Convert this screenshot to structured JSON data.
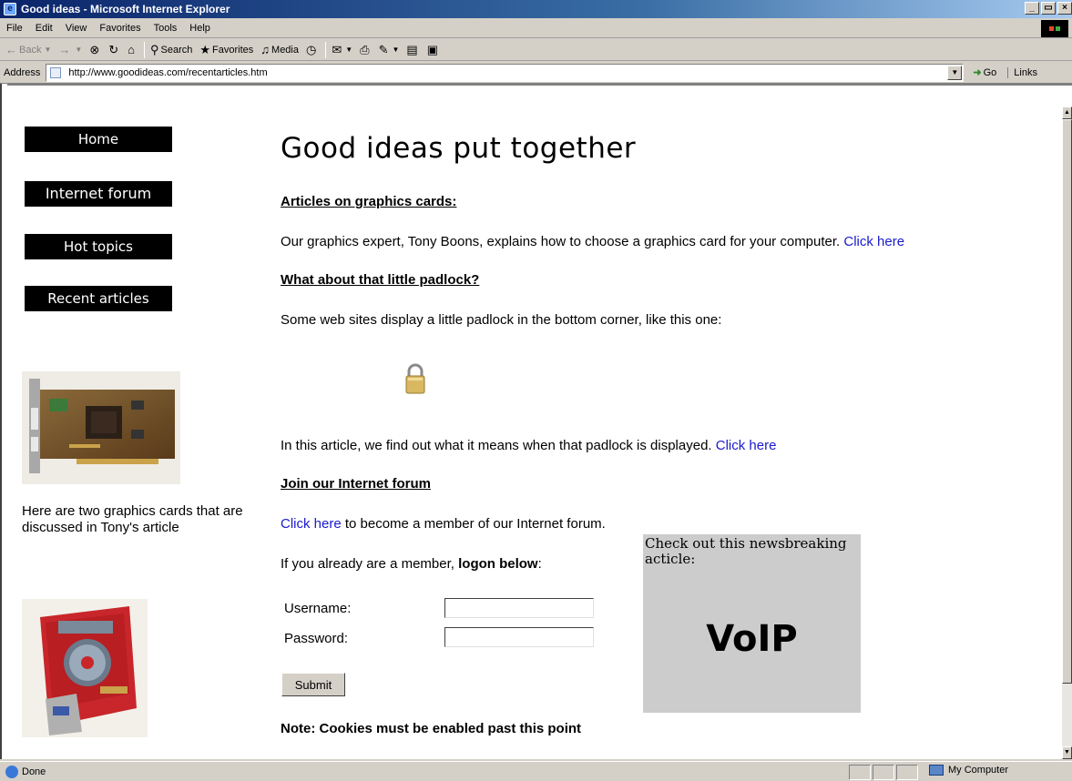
{
  "window": {
    "title": "Good ideas - Microsoft Internet Explorer",
    "buttons": [
      "_",
      "\u0001",
      "X"
    ]
  },
  "menubar": {
    "items": [
      "File",
      "Edit",
      "View",
      "Favorites",
      "Tools",
      "Help"
    ]
  },
  "toolbar": {
    "back": "Back",
    "search": "Search",
    "favorites": "Favorites",
    "media": "Media"
  },
  "addressbar": {
    "label": "Address",
    "url": "http://www.goodideas.com/recentarticles.htm",
    "go": "Go",
    "links": "Links"
  },
  "sidebar": {
    "nav": [
      "Home",
      "Internet forum",
      "Hot topics",
      "Recent articles"
    ],
    "caption": "Here are two graphics cards that are discussed in Tony's article"
  },
  "main": {
    "title": "Good ideas put together",
    "section1": {
      "heading": "Articles on graphics cards:",
      "text": "Our graphics expert, Tony Boons, explains how to choose a graphics card for your computer. ",
      "link": "Click here"
    },
    "section2": {
      "heading": "What about that little padlock?",
      "text": "Some web sites display a little padlock in the bottom corner, like this one:",
      "text2": "In this article, we find out what it means when that padlock is displayed. ",
      "link": "Click here"
    },
    "section3": {
      "heading": "Join our Internet forum",
      "link": "Click here",
      "text": " to become a member of our Internet forum.",
      "logon_prefix": "If you already are a member, ",
      "logon_bold": "logon below",
      "logon_suffix": ":"
    },
    "form": {
      "username_label": "Username:",
      "password_label": "Password:",
      "submit": "Submit"
    },
    "note": "Note: Cookies must be enabled past this point"
  },
  "promo": {
    "text": "Check out this newsbreaking acticle:",
    "headline": "VoIP"
  },
  "statusbar": {
    "status": "Done",
    "zone": "My Computer"
  }
}
